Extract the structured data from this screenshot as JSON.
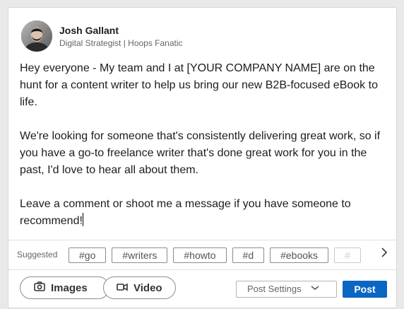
{
  "author": {
    "name": "Josh Gallant",
    "headline": "Digital Strategist | Hoops Fanatic"
  },
  "post": {
    "paragraphs": [
      "Hey everyone - My team and I at [YOUR COMPANY NAME] are on the hunt for a content writer to help us bring our new B2B-focused eBook to life.",
      "We're looking for someone that's consistently delivering great work, so if you have a go-to freelance writer that's done great work for you in the past, I'd love to hear all about them.",
      "Leave a comment or shoot me a message if you have someone to recommend!"
    ]
  },
  "suggested": {
    "label": "Suggested",
    "tags": [
      "#go",
      "#writers",
      "#howto",
      "#d",
      "#ebooks",
      "#"
    ]
  },
  "toolbar": {
    "images_label": "Images",
    "video_label": "Video",
    "post_settings_label": "Post Settings",
    "post_label": "Post"
  },
  "colors": {
    "primary": "#0a66c2"
  },
  "icons": {
    "next": "chevron-right-icon",
    "images": "camera-icon",
    "video": "video-camera-icon",
    "settings_dropdown": "chevron-down-icon"
  }
}
